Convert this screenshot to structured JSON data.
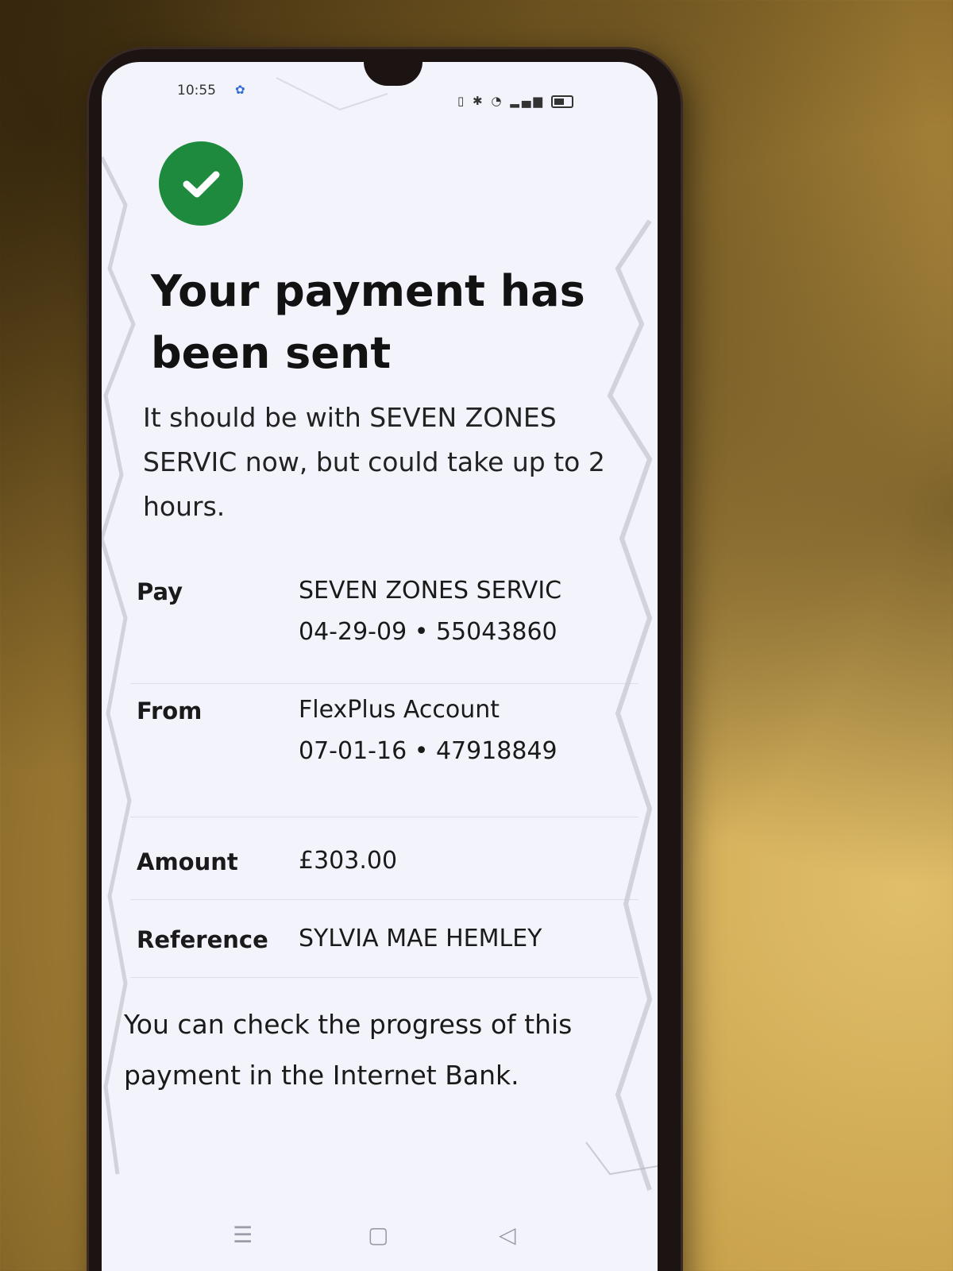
{
  "status_bar": {
    "time": "10:55"
  },
  "confirmation": {
    "title": "Your payment has been sent",
    "message": "It should be with SEVEN ZONES SERVIC now, but could take up to 2 hours."
  },
  "details": [
    {
      "label": "Pay",
      "line1": "SEVEN ZONES SERVIC",
      "line2": "04-29-09 • 55043860"
    },
    {
      "label": "From",
      "line1": "FlexPlus Account",
      "line2": "07-01-16 • 47918849"
    },
    {
      "label": "Amount",
      "line1": "£303.00",
      "line2": ""
    },
    {
      "label": "Reference",
      "line1": "SYLVIA MAE HEMLEY",
      "line2": ""
    }
  ],
  "footer_note": "You can check the progress of this payment in the Internet Bank.",
  "icons": {
    "success": "check-circle-icon",
    "nav": [
      "recent-apps-icon",
      "home-icon",
      "back-icon"
    ]
  },
  "colors": {
    "success_green": "#1d8a3d",
    "screen_background": "#f3f4fb",
    "text": "#121212"
  }
}
